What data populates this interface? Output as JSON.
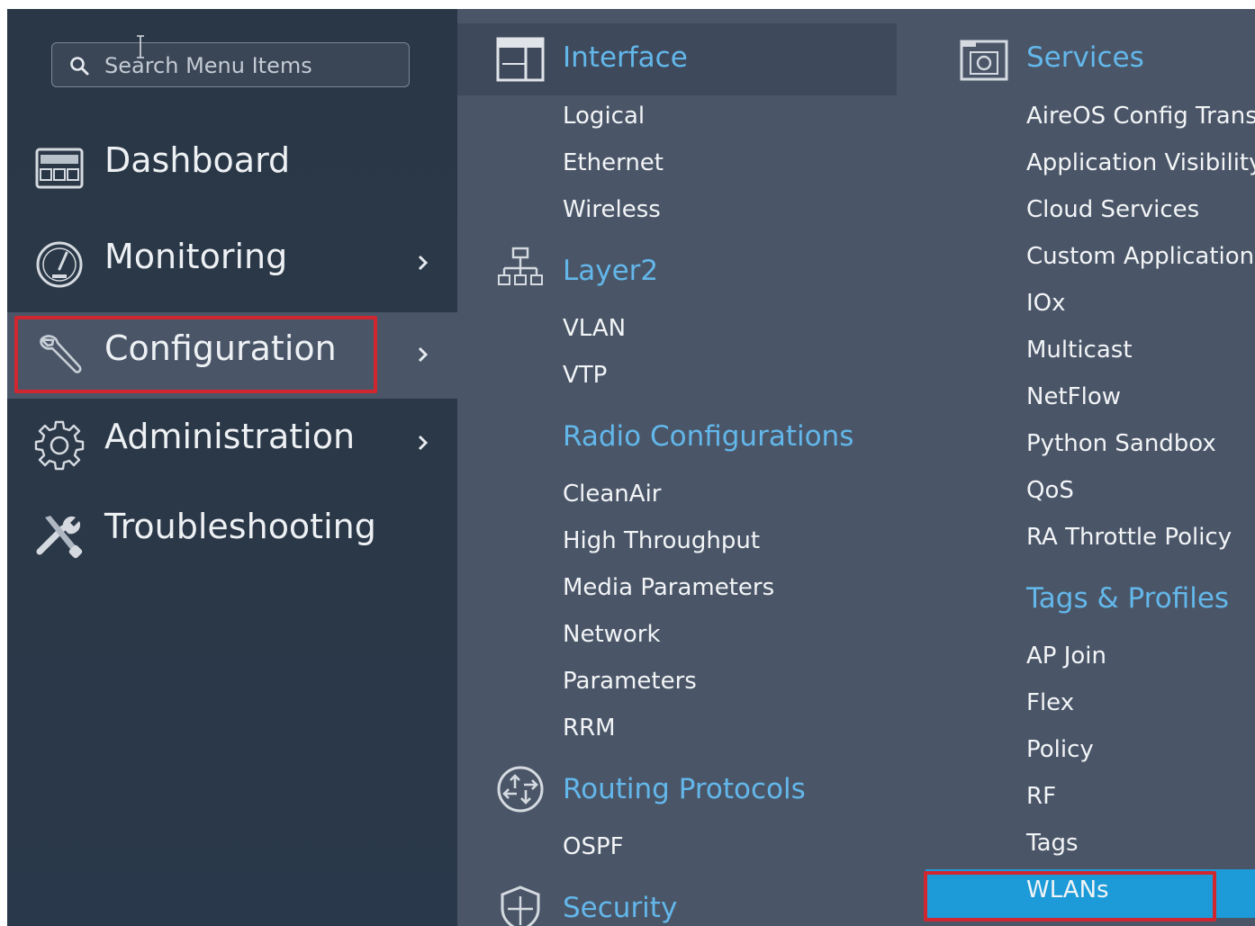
{
  "search": {
    "placeholder": "Search Menu Items"
  },
  "left_nav": {
    "items": [
      {
        "label": "Dashboard",
        "icon": "dashboard-icon",
        "has_submenu": false
      },
      {
        "label": "Monitoring",
        "icon": "gauge-icon",
        "has_submenu": true
      },
      {
        "label": "Configuration",
        "icon": "wrench-icon",
        "has_submenu": true,
        "selected": true
      },
      {
        "label": "Administration",
        "icon": "gear-icon",
        "has_submenu": true
      },
      {
        "label": "Troubleshooting",
        "icon": "tools-icon",
        "has_submenu": false
      }
    ]
  },
  "config_menu": {
    "interface": {
      "title": "Interface",
      "icon": "interface-icon",
      "items": [
        "Logical",
        "Ethernet",
        "Wireless"
      ]
    },
    "layer2": {
      "title": "Layer2",
      "icon": "network-tree-icon",
      "items": [
        "VLAN",
        "VTP"
      ]
    },
    "radio": {
      "title": "Radio Configurations",
      "items": [
        "CleanAir",
        "High Throughput",
        "Media Parameters",
        "Network",
        "Parameters",
        "RRM"
      ]
    },
    "routing": {
      "title": "Routing Protocols",
      "icon": "router-icon",
      "items": [
        "OSPF"
      ]
    },
    "security": {
      "title": "Security",
      "icon": "shield-icon"
    },
    "services": {
      "title": "Services",
      "icon": "services-icon",
      "items": [
        "AireOS Config Trans",
        "Application Visibility",
        "Cloud Services",
        "Custom Application",
        "IOx",
        "Multicast",
        "NetFlow",
        "Python Sandbox",
        "QoS",
        "RA Throttle Policy"
      ]
    },
    "tags_profiles": {
      "title": "Tags & Profiles",
      "items": [
        "AP Join",
        "Flex",
        "Policy",
        "RF",
        "Tags",
        "WLANs"
      ],
      "highlighted": "WLANs"
    }
  },
  "colors": {
    "nav_bg": "#2a3747",
    "panel_bg": "#4a5668",
    "accent": "#63b7ea",
    "highlight": "#1d9bd8",
    "annotation_red": "#d02630"
  }
}
